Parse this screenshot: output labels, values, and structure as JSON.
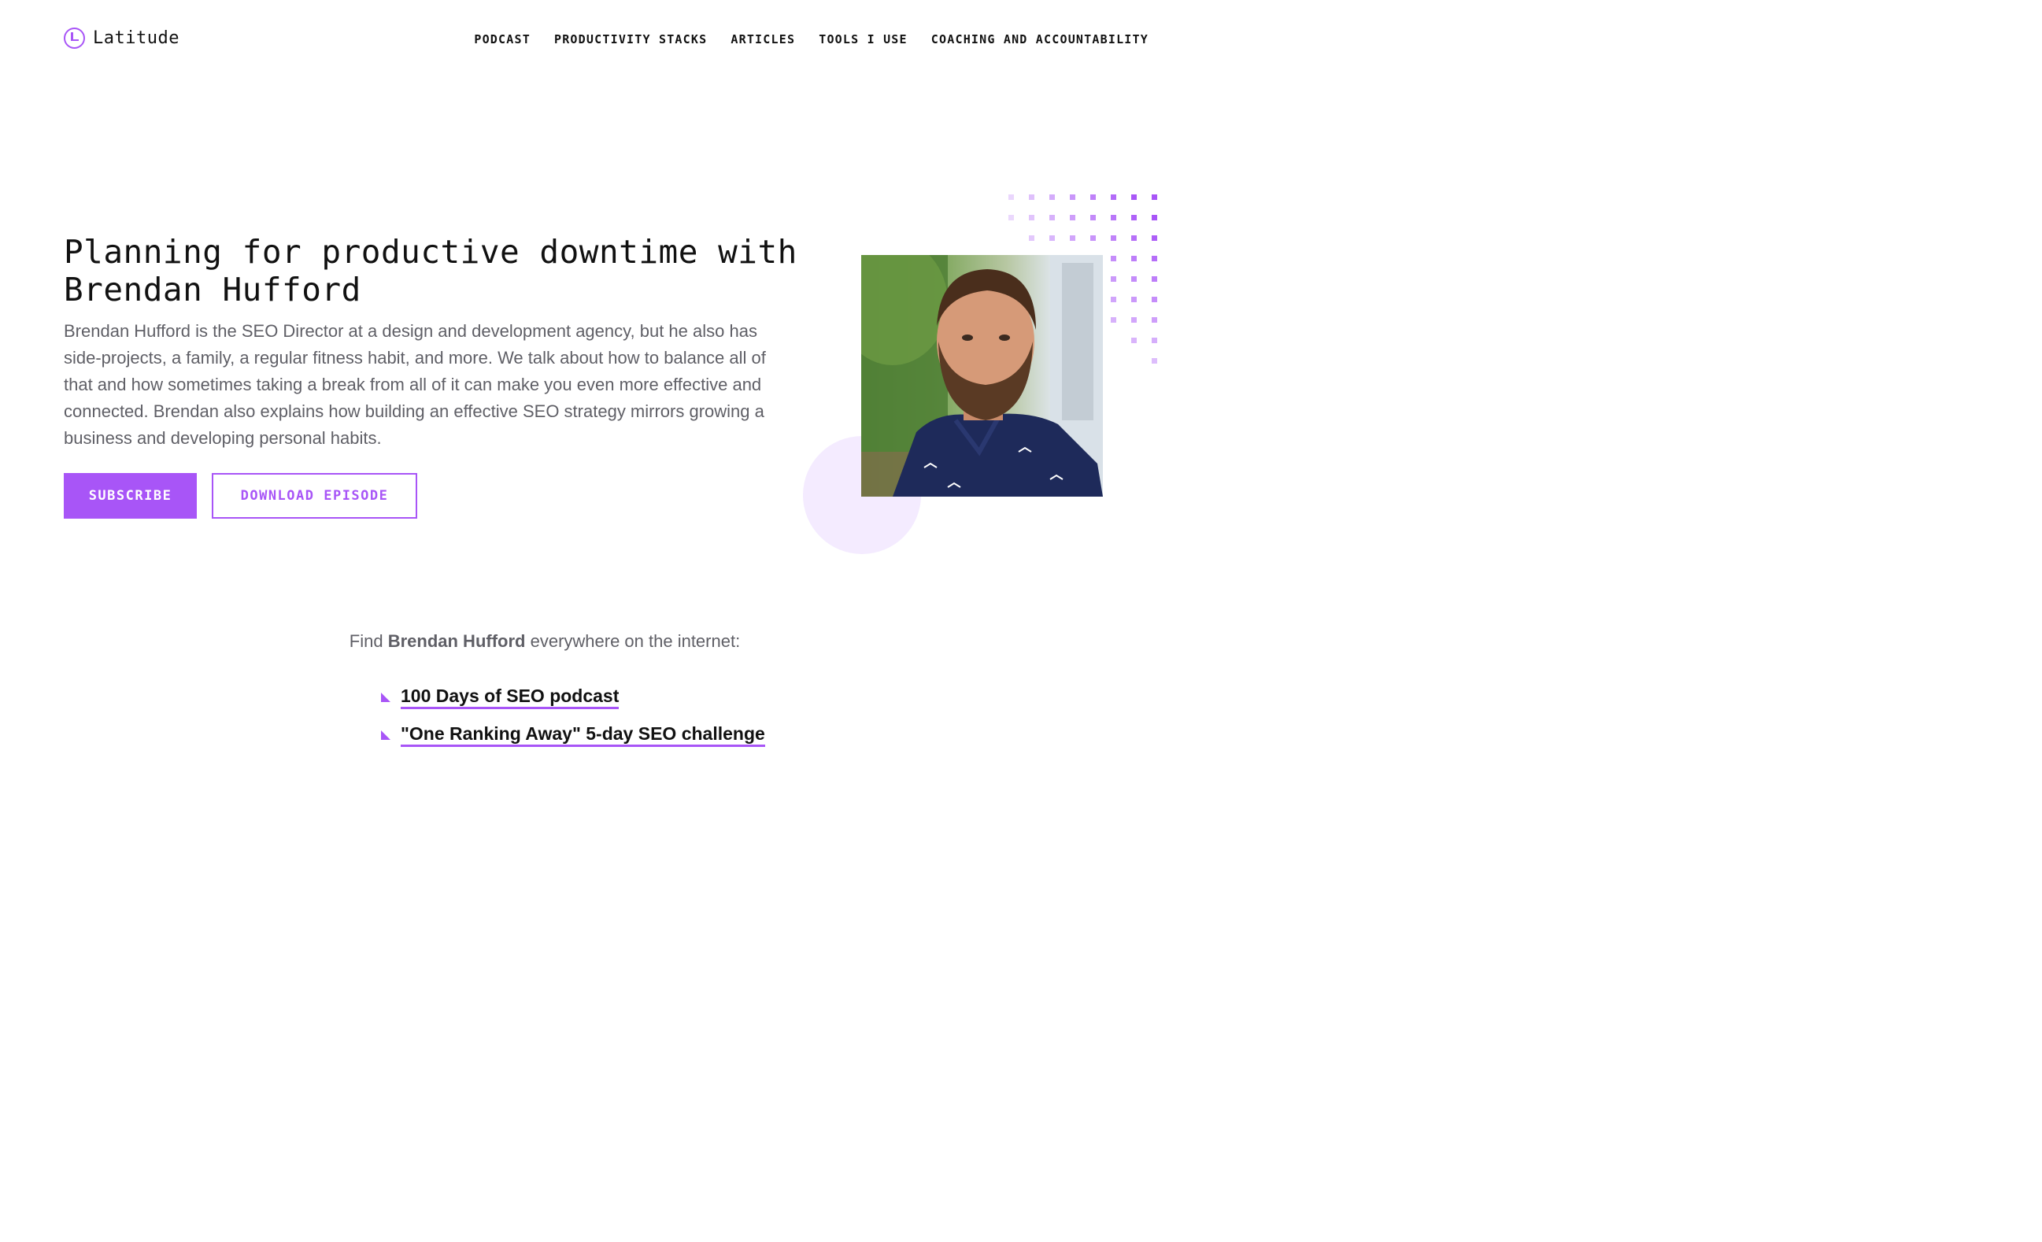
{
  "header": {
    "brand_name": "Latitude",
    "nav": [
      {
        "label": "PODCAST"
      },
      {
        "label": "PRODUCTIVITY STACKS"
      },
      {
        "label": "ARTICLES"
      },
      {
        "label": "TOOLS I USE"
      },
      {
        "label": "COACHING AND ACCOUNTABILITY"
      }
    ]
  },
  "hero": {
    "title": "Planning for productive downtime with Brendan Hufford",
    "description": "Brendan Hufford is the SEO Director at a design and development agency, but he also has side-projects, a family, a regular fitness habit, and more. We talk about how to balance all of that and how sometimes taking a break from all of it can make you even more effective and connected. Brendan also explains how building an effective SEO strategy mirrors growing a business and developing personal habits.",
    "subscribe_label": "SUBSCRIBE",
    "download_label": "DOWNLOAD EPISODE"
  },
  "find": {
    "prefix": "Find",
    "name": "Brendan Hufford",
    "suffix": "everywhere on the internet:"
  },
  "links": [
    {
      "label": "100 Days of SEO podcast"
    },
    {
      "label": "\"One Ranking Away\" 5-day SEO challenge"
    }
  ],
  "colors": {
    "accent": "#a855f7",
    "accent_light": "#f4ebff",
    "body_text": "#5f5f66"
  }
}
